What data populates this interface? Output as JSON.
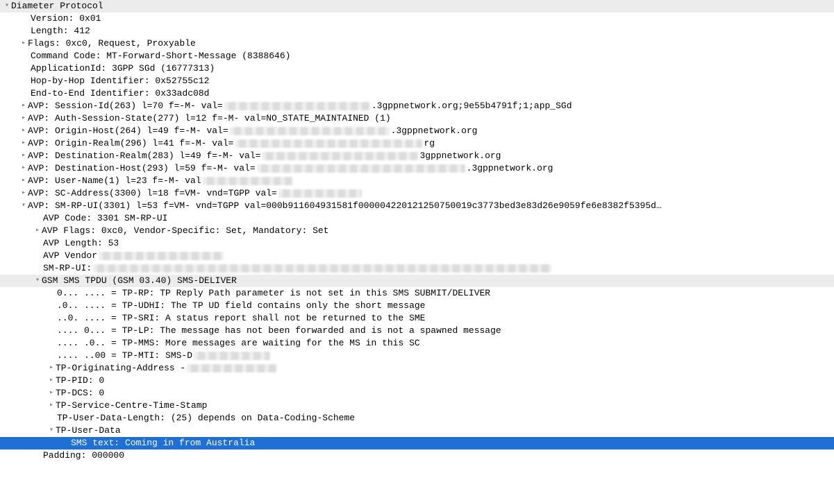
{
  "glyph": {
    "right": "▸",
    "down": "▾"
  },
  "root": "Diameter Protocol",
  "l1": {
    "version": "Version: 0x01",
    "length": "Length: 412",
    "flags": "Flags: 0xc0, Request, Proxyable",
    "cmd": "Command Code: MT-Forward-Short-Message (8388646)",
    "appid": "ApplicationId: 3GPP SGd (16777313)",
    "hop": "Hop-by-Hop Identifier: 0x52755c12",
    "end": "End-to-End Identifier: 0x33adc08d",
    "session_pre": "AVP: Session-Id(263) l=70 f=-M- val=",
    "session_post": ".3gppnetwork.org;9e55b4791f;1;app_SGd",
    "auth": "AVP: Auth-Session-State(277) l=12 f=-M- val=NO_STATE_MAINTAINED (1)",
    "ohost_pre": "AVP: Origin-Host(264) l=49 f=-M- val=",
    "ohost_post": ".3gppnetwork.org",
    "orealm_pre": "AVP: Origin-Realm(296) l=41 f=-M- val=",
    "orealm_post": "rg",
    "drealm_pre": "AVP: Destination-Realm(283) l=49 f=-M- val=",
    "drealm_post": "3gppnetwork.org",
    "dhost_pre": "AVP: Destination-Host(293) l=59 f=-M- val=",
    "dhost_post": ".3gppnetwork.org",
    "uname_pre": "AVP: User-Name(1) l=23 f=-M- val",
    "sca_pre": "AVP: SC-Address(3300) l=18 f=VM- vnd=TGPP val=",
    "smrpui": "AVP: SM-RP-UI(3301) l=53 f=VM- vnd=TGPP val=000b911604931581f0000042201212507500­19c3773bed3e83d26e9059fe6e8382f5395d…",
    "padding": "Padding: 000000"
  },
  "l2": {
    "code": "AVP Code: 3301 SM-RP-UI",
    "flags": "AVP Flags: 0xc0, Vendor-Specific: Set, Mandatory: Set",
    "len": "AVP Length: 53",
    "vendor_pre": "AVP Vendor ",
    "uiraw": "SM-RP-UI: ",
    "tpdu": "GSM SMS TPDU (GSM 03.40) SMS-DELIVER"
  },
  "l3": {
    "rp": "0... .... = TP-RP: TP Reply Path parameter is not set in this SMS SUBMIT/DELIVER",
    "udhi": ".0.. .... = TP-UDHI: The TP UD field contains only the short message",
    "sri": "..0. .... = TP-SRI: A status report shall not be returned to the SME",
    "lp": ".... 0... = TP-LP: The message has not been forwarded and is not a spawned message",
    "mms": ".... .0.. = TP-MMS: More messages are waiting for the MS in this SC",
    "mti_pre": ".... ..00 = TP-MTI: SMS-D",
    "oa_pre": "TP-Originating-Address - ",
    "pid": "TP-PID: 0",
    "dcs": "TP-DCS: 0",
    "scts": "TP-Service-Centre-Time-Stamp",
    "udl": "TP-User-Data-Length: (25) depends on Data-Coding-Scheme",
    "ud": "TP-User-Data"
  },
  "sms": "SMS text: Coming in from Australia"
}
